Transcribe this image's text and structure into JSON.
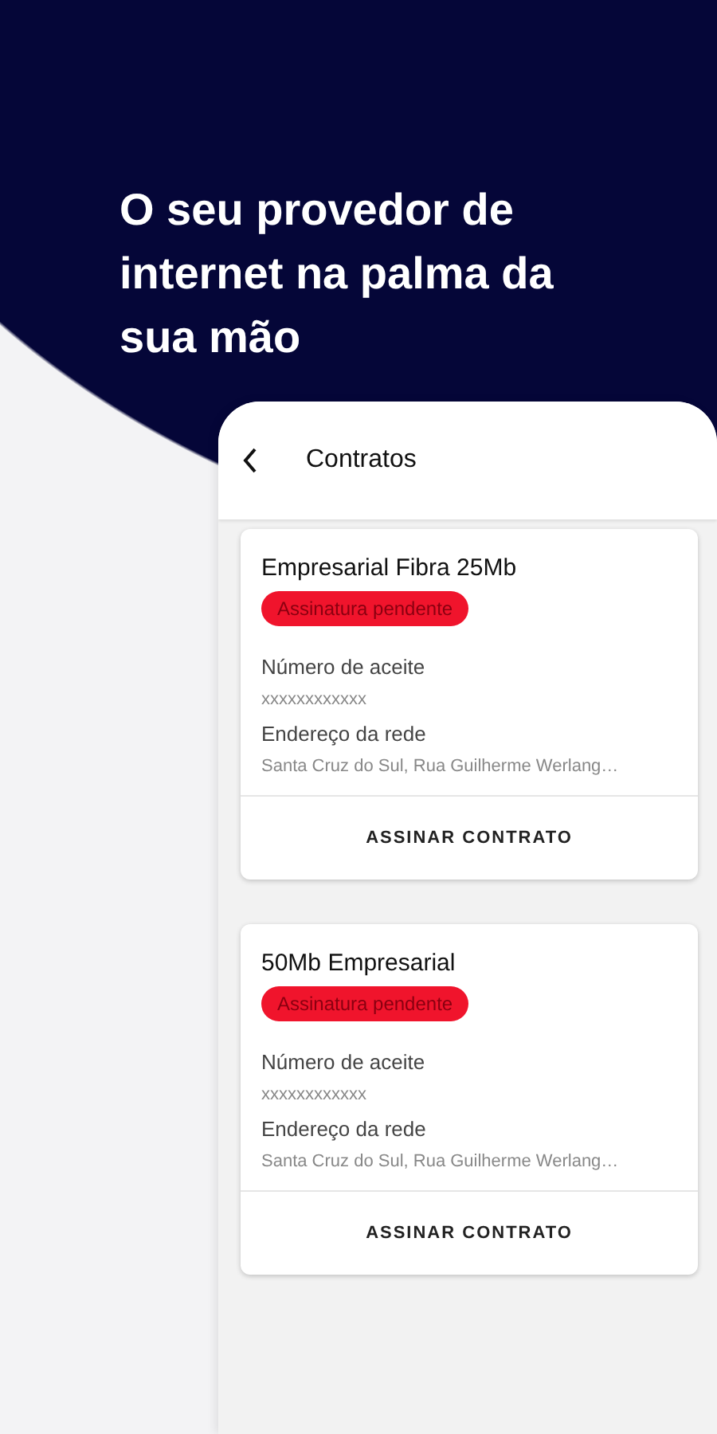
{
  "headline": "O seu provedor de internet na palma da sua mão",
  "screen": {
    "title": "Contratos",
    "contracts": [
      {
        "name": "Empresarial Fibra 25Mb",
        "status": "Assinatura pendente",
        "fields": [
          {
            "label": "Número de aceite",
            "value": "xxxxxxxxxxxx"
          },
          {
            "label": "Endereço da rede",
            "value": "Santa Cruz do Sul, Rua Guilherme Werlang…"
          }
        ],
        "action": "ASSINAR CONTRATO"
      },
      {
        "name": "50Mb Empresarial",
        "status": "Assinatura pendente",
        "fields": [
          {
            "label": "Número de aceite",
            "value": "xxxxxxxxxxxx"
          },
          {
            "label": "Endereço da rede",
            "value": "Santa Cruz do Sul, Rua Guilherme Werlang…"
          }
        ],
        "action": "ASSINAR CONTRATO"
      }
    ]
  }
}
